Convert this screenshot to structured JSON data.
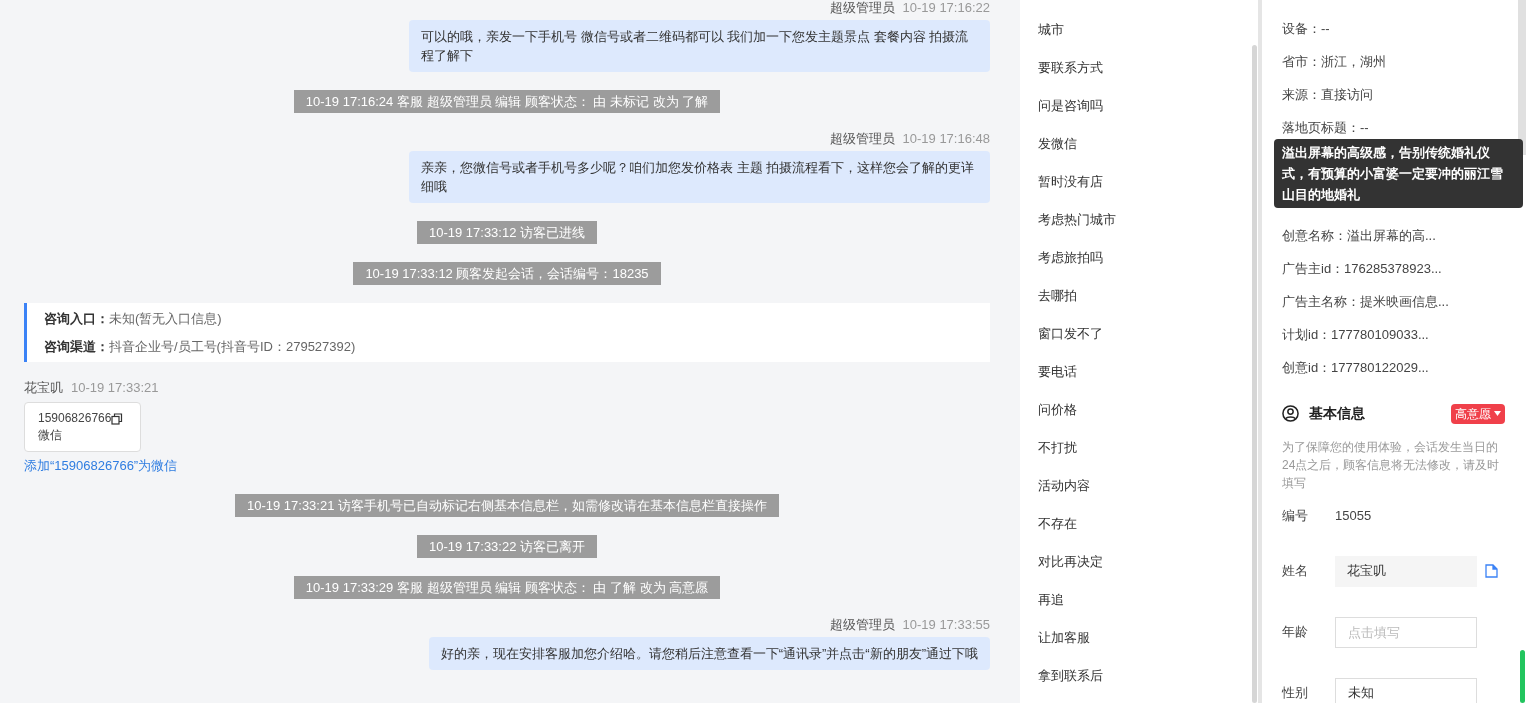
{
  "chat": [
    {
      "kind": "agent",
      "name": "超级管理员",
      "time": "10-19 17:16:22",
      "text": "可以的哦，亲发一下手机号 微信号或者二维码都可以 我们加一下您发主题景点 套餐内容 拍摄流程了解下"
    },
    {
      "kind": "system",
      "text": "10-19 17:16:24 客服 超级管理员 编辑 顾客状态： 由 未标记 改为 了解"
    },
    {
      "kind": "agent",
      "name": "超级管理员",
      "time": "10-19 17:16:48",
      "text": "亲亲，您微信号或者手机号多少呢？咱们加您发价格表 主题 拍摄流程看下，这样您会了解的更详细哦"
    },
    {
      "kind": "system",
      "text": "10-19 17:33:12 访客已进线"
    },
    {
      "kind": "system",
      "text": "10-19 17:33:12 顾客发起会话，会话编号：18235"
    },
    {
      "kind": "info",
      "lines": [
        {
          "label": "咨询入口：",
          "value": "未知(暂无入口信息)"
        },
        {
          "label": "咨询渠道：",
          "value": "抖音企业号/员工号(抖音号ID：279527392)"
        }
      ]
    },
    {
      "kind": "visitor",
      "name": "花宝叽",
      "time": "10-19 17:33:21",
      "phone": "15906826766",
      "type": "微信",
      "link": "添加“15906826766”为微信"
    },
    {
      "kind": "system",
      "text": "10-19 17:33:21 访客手机号已自动标记右侧基本信息栏，如需修改请在基本信息栏直接操作"
    },
    {
      "kind": "system",
      "text": "10-19 17:33:22 访客已离开"
    },
    {
      "kind": "system",
      "text": "10-19 17:33:29 客服 超级管理员 编辑 顾客状态： 由 了解 改为 高意愿"
    },
    {
      "kind": "agent",
      "name": "超级管理员",
      "time": "10-19 17:33:55",
      "text": "好的亲，现在安排客服加您介绍哈。请您稍后注意查看一下“通讯录”并点击“新的朋友”通过下哦"
    }
  ],
  "quick_replies": [
    "城市",
    "要联系方式",
    "问是咨询吗",
    "发微信",
    "暂时没有店",
    "考虑热门城市",
    "考虑旅拍吗",
    "去哪拍",
    "窗口发不了",
    "要电话",
    "问价格",
    "不打扰",
    "活动内容",
    "不存在",
    "对比再决定",
    "再追",
    "让加客服",
    "拿到联系后"
  ],
  "visit_info_top": [
    "设备：--",
    "省市：浙江，湖州",
    "来源：直接访问",
    "落地页标题：--"
  ],
  "tooltip": "溢出屏幕的高级感，告别传统婚礼仪式，有预算的小富婆一定要冲的丽江雪山目的地婚礼",
  "visit_info_bottom": [
    "创意名称：溢出屏幕的高...",
    "广告主id：176285378923...",
    "广告主名称：提米映画信息...",
    "计划id：177780109033...",
    "创意id：177780122029..."
  ],
  "basic_info": {
    "title": "基本信息",
    "status": "高意愿",
    "note": "为了保障您的使用体验，会话发生当日的24点之后，顾客信息将无法修改，请及时填写",
    "fields": [
      {
        "kind": "text",
        "label": "编号",
        "value": "15055"
      },
      {
        "kind": "readonly",
        "label": "姓名",
        "value": "花宝叽"
      },
      {
        "kind": "input",
        "label": "年龄",
        "placeholder": "点击填写"
      },
      {
        "kind": "input",
        "label": "性别",
        "value": "未知"
      }
    ]
  }
}
